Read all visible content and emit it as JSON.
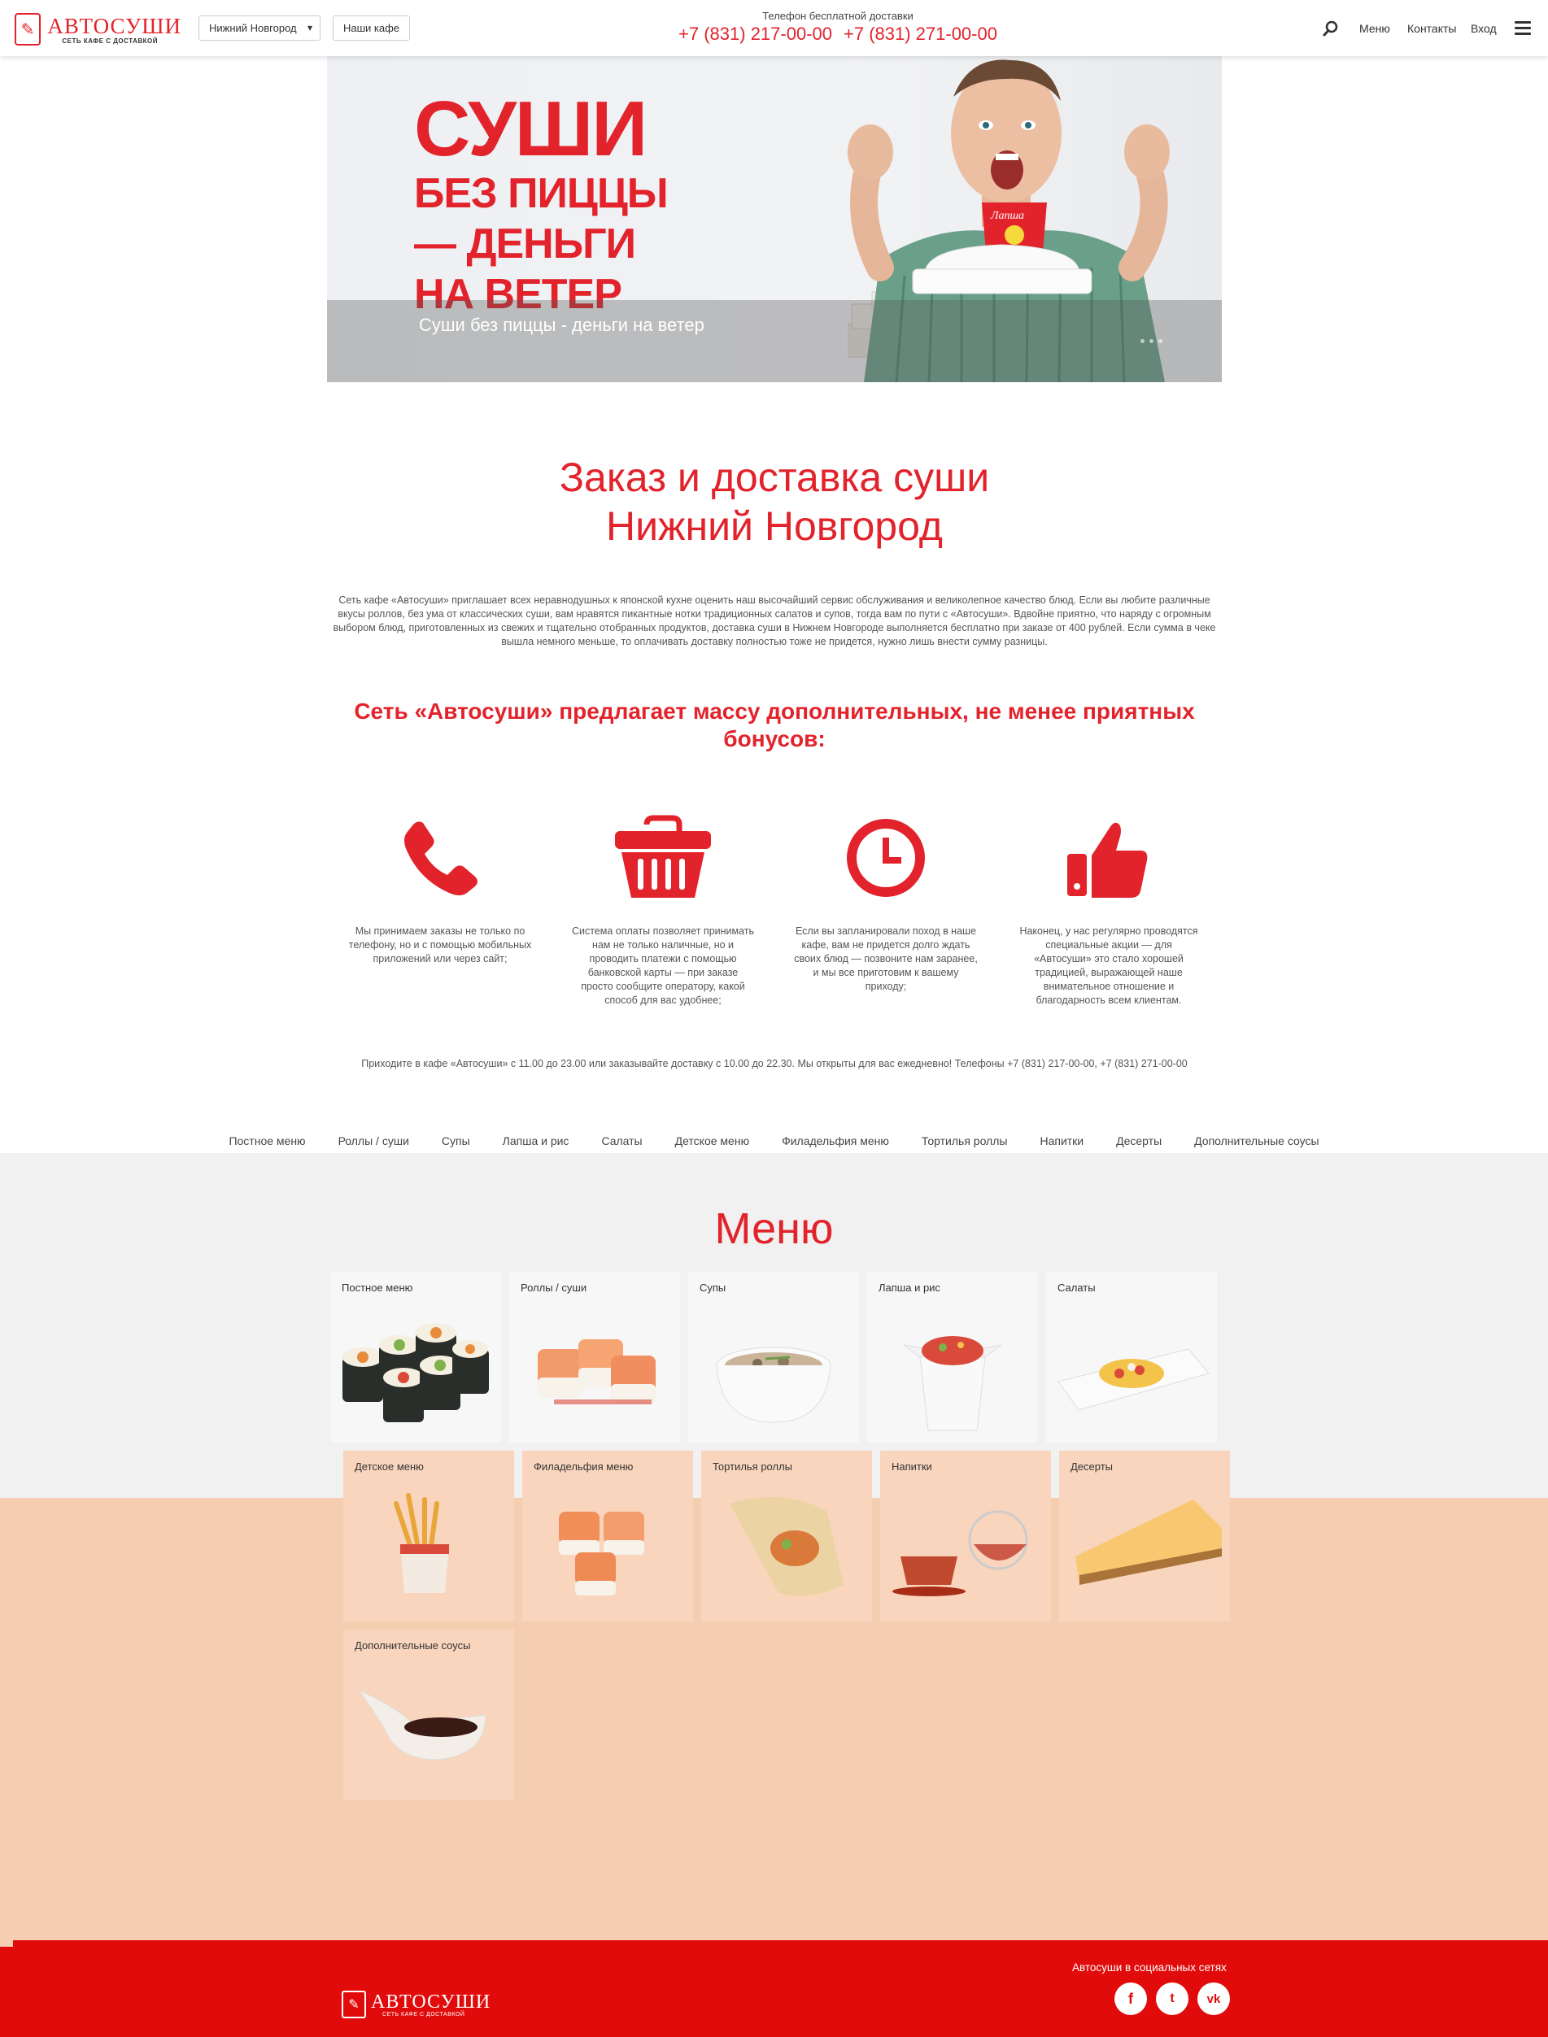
{
  "header": {
    "logo_name": "АВТОСУШИ",
    "logo_sub": "СЕТЬ КАФЕ С ДОСТАВКОЙ",
    "city": "Нижний Новгород",
    "cafes_button": "Наши кафе",
    "phone_caption": "Телефон бесплатной доставки",
    "phone1": "+7 (831) 217-00-00",
    "phone2": "+7 (831) 271-00-00",
    "nav": {
      "menu": "Меню",
      "contacts": "Контакты",
      "login": "Вход"
    }
  },
  "hero": {
    "headline_1": "СУШИ",
    "headline_2": "БЕЗ ПИЦЦЫ",
    "headline_3": "— ДЕНЬГИ",
    "headline_4": "НА ВЕТЕР",
    "caption": "Суши без пиццы - деньги на ветер",
    "box_label": "Лапша"
  },
  "intro": {
    "title_1": "Заказ и доставка суши",
    "title_2": "Нижний Новгород",
    "text": "Сеть кафе «Автосуши» приглашает всех неравнодушных к японской кухне оценить наш высочайший сервис обслуживания и великолепное качество блюд. Если вы любите различные вкусы роллов, без ума от классических суши, вам нравятся пикантные нотки традиционных салатов и супов, тогда вам по пути с «Автосуши». Вдвойне приятно, что наряду с огромным выбором блюд, приготовленных из свежих и тщательно отобранных продуктов, доставка суши в Нижнем Новгороде выполняется бесплатно при заказе от 400 рублей. Если сумма в чеке вышла немного меньше, то оплачивать доставку полностью тоже не придется, нужно лишь внести сумму разницы.",
    "bonus_title": "Сеть «Автосуши» предлагает массу дополнительных, не менее приятных бонусов:"
  },
  "features": [
    {
      "icon": "phone-icon",
      "text": "Мы принимаем заказы не только по телефону, но и с помощью мобильных приложений или через сайт;"
    },
    {
      "icon": "basket-icon",
      "text": "Система оплаты позволяет принимать нам не только наличные, но и проводить платежи с помощью банковской карты — при заказе просто сообщите оператору, какой способ для вас удобнее;"
    },
    {
      "icon": "clock-icon",
      "text": "Если вы запланировали поход в наше кафе, вам не придется долго ждать своих блюд — позвоните нам заранее, и мы все приготовим к вашему приходу;"
    },
    {
      "icon": "thumbs-up-icon",
      "text": "Наконец, у нас регулярно проводятся специальные акции — для «Автосуши» это стало хорошей традицией, выражающей наше внимательное отношение и благодарность всем клиентам."
    }
  ],
  "hours": "Приходите в кафе «Автосуши» с 11.00 до 23.00 или заказывайте доставку с 10.00 до 22.30. Мы открыты для вас ежедневно! Телефоны +7 (831) 217-00-00, +7 (831) 271-00-00",
  "categories": [
    "Постное меню",
    "Роллы / суши",
    "Супы",
    "Лапша и рис",
    "Салаты",
    "Детское меню",
    "Филадельфия меню",
    "Тортилья роллы",
    "Напитки",
    "Десерты",
    "Дополнительные соусы"
  ],
  "menu": {
    "title": "Меню",
    "tiles": [
      "Постное меню",
      "Роллы / суши",
      "Супы",
      "Лапша и рис",
      "Салаты",
      "Детское меню",
      "Филадельфия меню",
      "Тортилья роллы",
      "Напитки",
      "Десерты",
      "Дополнительные соусы"
    ]
  },
  "footer": {
    "logo_name": "АВТОСУШИ",
    "logo_sub": "СЕТЬ КАФЕ С ДОСТАВКОЙ",
    "social_caption": "Автосуши в социальных сетях",
    "social": [
      "f",
      "t",
      "vk"
    ]
  },
  "colors": {
    "accent": "#e2232b",
    "footer": "#e20b0b",
    "peach": "#f5cdb1",
    "grey_band": "#f1f1f1"
  }
}
